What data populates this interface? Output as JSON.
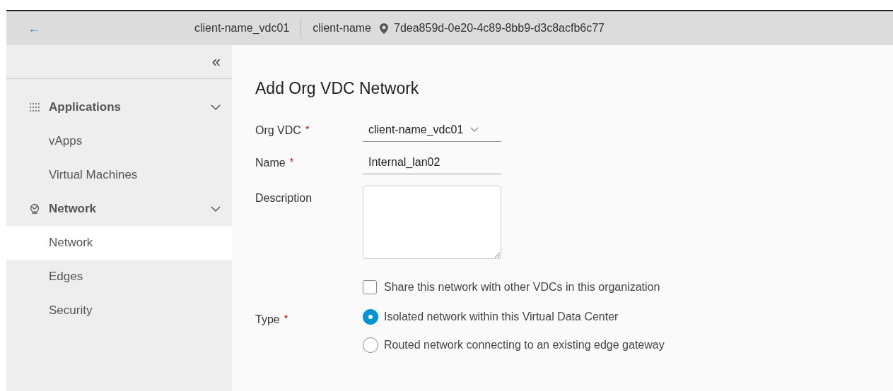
{
  "header": {
    "back": "←",
    "vdc": "client-name_vdc01",
    "org": "client-name",
    "id": "7dea859d-0e20-4c89-8bb9-d3c8acfb6c77"
  },
  "sidebar": {
    "collapse": "«",
    "groups": [
      {
        "label": "Applications",
        "expanded": true,
        "items": [
          {
            "label": "vApps",
            "selected": false
          },
          {
            "label": "Virtual Machines",
            "selected": false
          }
        ]
      },
      {
        "label": "Network",
        "expanded": true,
        "items": [
          {
            "label": "Network",
            "selected": true
          },
          {
            "label": "Edges",
            "selected": false
          },
          {
            "label": "Security",
            "selected": false
          }
        ]
      }
    ]
  },
  "form": {
    "title": "Add Org VDC Network",
    "fields": [
      {
        "kind": "select",
        "label": "Org VDC",
        "required_mark": "*",
        "value": "client-name_vdc01"
      },
      {
        "kind": "text",
        "label": "Name",
        "required_mark": "*",
        "value": "Internal_lan02"
      },
      {
        "kind": "textarea",
        "label": "Description"
      },
      {
        "kind": "checkbox",
        "label": "Share this network with other VDCs in this organization",
        "checked": false
      },
      {
        "kind": "radio",
        "label": "Type",
        "required_mark": "*",
        "options": [
          {
            "label": "Isolated network within this Virtual Data Center",
            "selected": true
          },
          {
            "label": "Routed network connecting to an existing edge gateway",
            "selected": false
          }
        ]
      }
    ]
  }
}
